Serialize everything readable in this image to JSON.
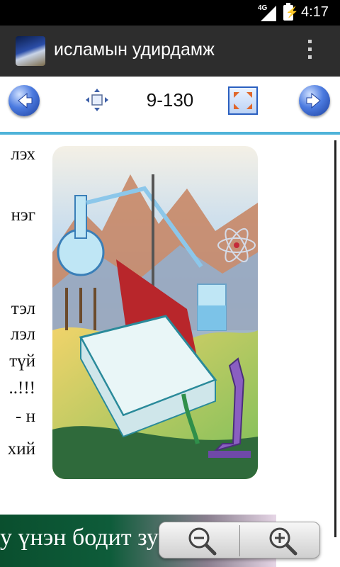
{
  "status_bar": {
    "network": "4G",
    "time": "4:17"
  },
  "action_bar": {
    "title": "исламын удирдамж",
    "icons": {
      "app": "app-icon",
      "overflow": "overflow-menu-icon"
    }
  },
  "toolbar": {
    "page_indicator": "9-130",
    "icons": {
      "prev": "arrow-left-icon",
      "fit": "fit-screen-icon",
      "fullscreen": "fullscreen-icon",
      "next": "arrow-right-icon"
    },
    "accent": "#4fb3d9"
  },
  "page": {
    "text_fragments": [
      "лэх",
      "нэг",
      "тэл",
      "лэл",
      "түй",
      "..!!!",
      "- н",
      "хий"
    ],
    "bottom_banner_text": "у үнэн бодит зу"
  },
  "zoom_controls": {
    "icons": {
      "zoom_out": "zoom-out-icon",
      "zoom_in": "zoom-in-icon"
    }
  }
}
